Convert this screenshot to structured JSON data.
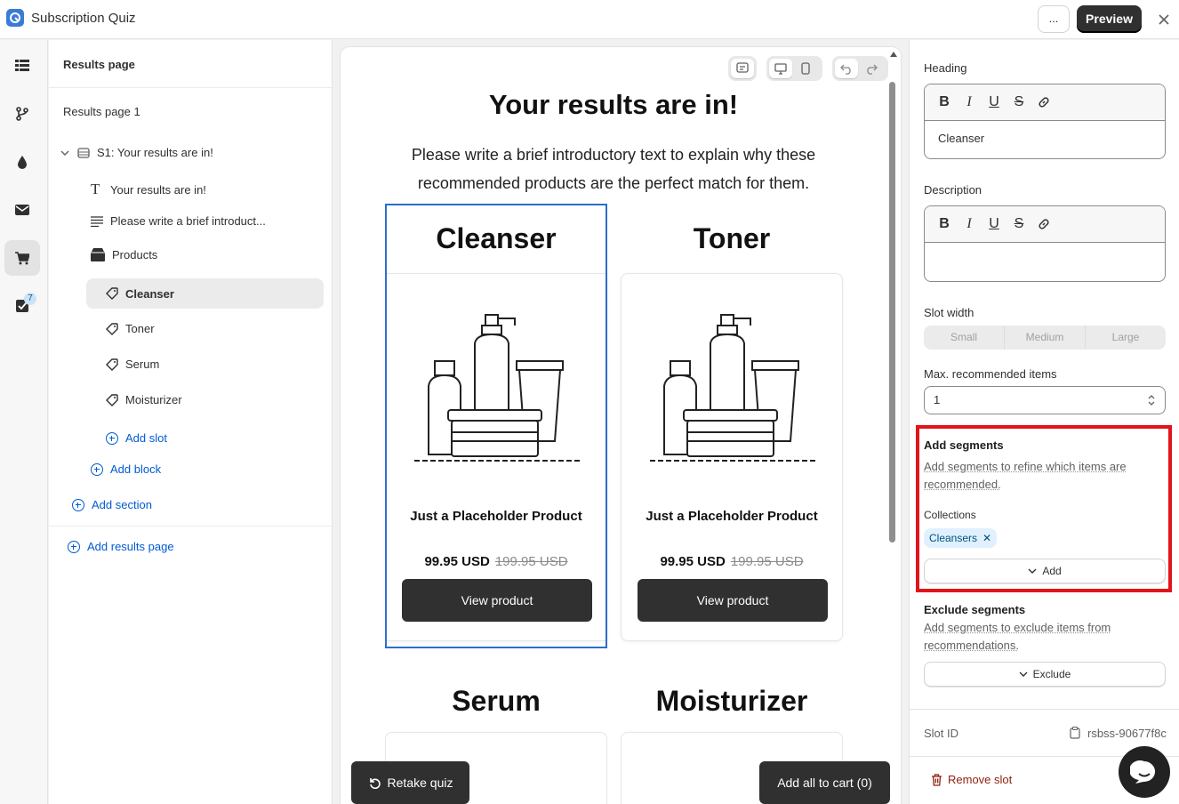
{
  "app": {
    "title": "Subscription Quiz",
    "more_label": "...",
    "preview_label": "Preview",
    "logo_icon": "quiz-logo-icon"
  },
  "rail": {
    "items": [
      "list-icon",
      "branch-icon",
      "drop-icon",
      "mail-icon",
      "cart-icon",
      "checklist-icon"
    ],
    "badge": "7"
  },
  "tree": {
    "header": "Results page",
    "page": "Results page 1",
    "section": "S1: Your results are in!",
    "blocks": {
      "heading": "Your results are in!",
      "text": "Please write a brief introduct...",
      "products": "Products"
    },
    "slots": [
      "Cleanser",
      "Toner",
      "Serum",
      "Moisturizer"
    ],
    "add_slot": "Add slot",
    "add_block": "Add block",
    "add_section": "Add section",
    "add_results_page": "Add results page"
  },
  "canvas": {
    "title": "Your results are in!",
    "intro": "Please write a brief introductory text to explain why these recommended products are the perfect match for them.",
    "cards": [
      {
        "slot": "Cleanser",
        "name": "Just a Placeholder Product",
        "price": "99.95 USD",
        "old_price": "199.95 USD",
        "button": "View product"
      },
      {
        "slot": "Toner",
        "name": "Just a Placeholder Product",
        "price": "99.95 USD",
        "old_price": "199.95 USD",
        "button": "View product"
      }
    ],
    "lower_slots": [
      "Serum",
      "Moisturizer"
    ],
    "retake_label": "Retake quiz",
    "add_all_label": "Add all to cart (0)"
  },
  "panel": {
    "heading_label": "Heading",
    "heading_value": "Cleanser",
    "description_label": "Description",
    "description_value": "",
    "rte_tools": [
      "B",
      "I",
      "U",
      "S"
    ],
    "slot_width_label": "Slot width",
    "slot_width_options": [
      "Small",
      "Medium",
      "Large"
    ],
    "max_items_label": "Max. recommended items",
    "max_items_value": "1",
    "add_segments_title": "Add segments",
    "add_segments_help": "Add segments to refine which items are recommended.",
    "collections_label": "Collections",
    "chip_label": "Cleansers",
    "add_label": "Add",
    "exclude_title": "Exclude segments",
    "exclude_help": "Add segments to exclude items from recommendations.",
    "exclude_label": "Exclude",
    "slot_id_label": "Slot ID",
    "slot_id_value": "rsbss-90677f8c",
    "remove_label": "Remove slot"
  },
  "colors": {
    "accent": "#005bd3",
    "highlight": "#e2141b",
    "dark_button": "#303030",
    "selection": "#2c6ecb"
  }
}
